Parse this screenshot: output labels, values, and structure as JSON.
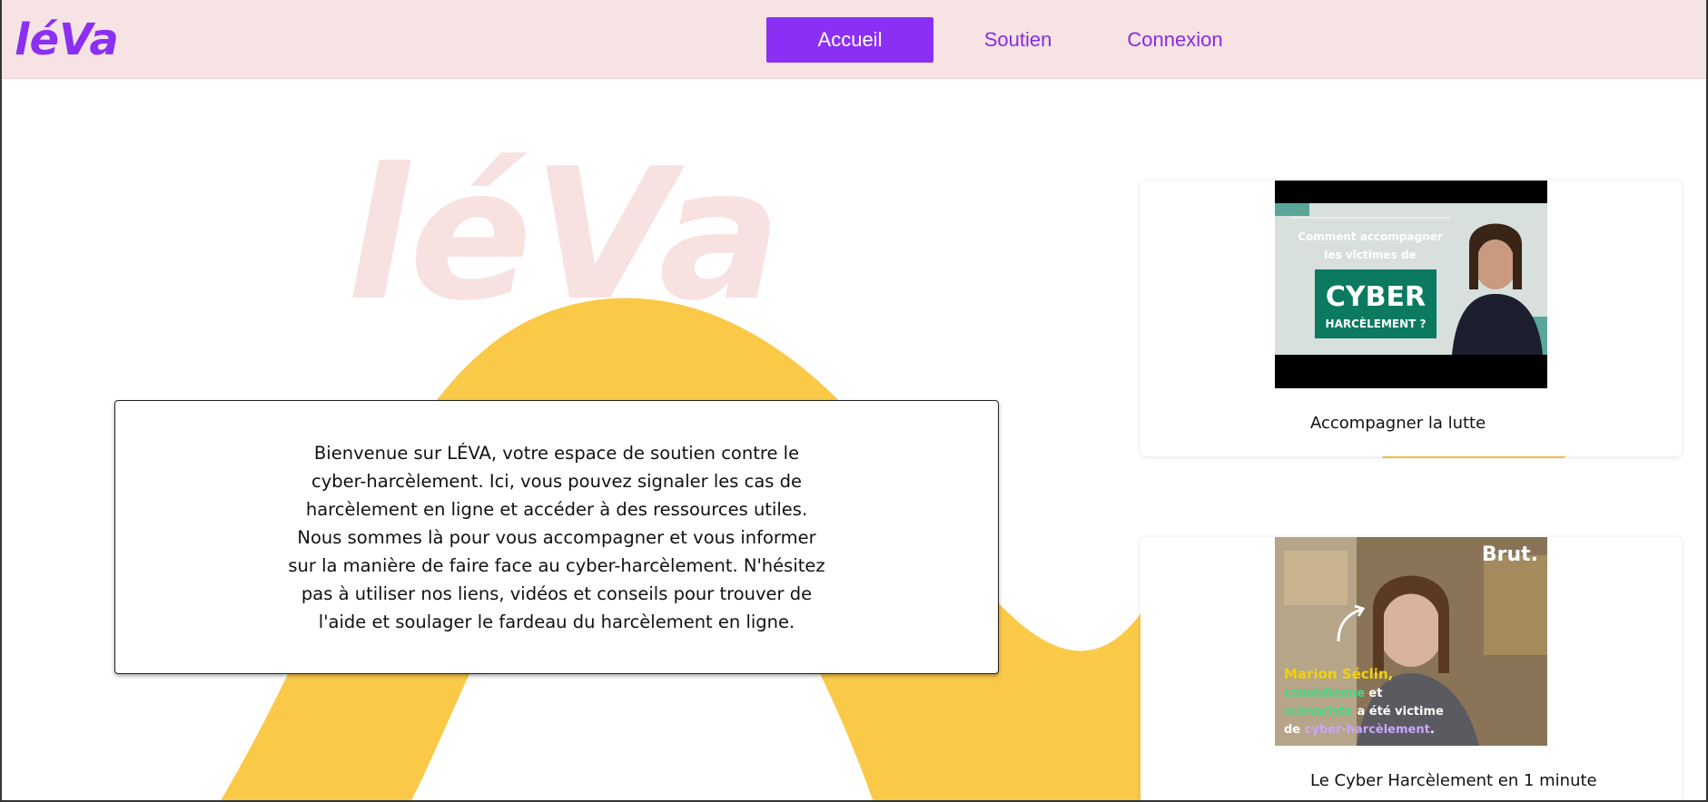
{
  "brand": {
    "logo_text": "léVa",
    "accent_color": "#8b2ff5",
    "header_bg": "#f7e3e4",
    "wave_color": "#fbc948",
    "watermark_color": "#f8e1e1"
  },
  "nav": {
    "items": [
      {
        "label": "Accueil",
        "active": true
      },
      {
        "label": "Soutien",
        "active": false
      },
      {
        "label": "Connexion",
        "active": false
      }
    ]
  },
  "welcome": {
    "text": "Bienvenue sur LÉVA, votre espace de soutien contre le cyber-harcèlement. Ici, vous pouvez signaler les cas de harcèlement en ligne et accéder à des ressources utiles. Nous sommes là pour vous accompagner et vous informer sur la manière de faire face au cyber-harcèlement. N'hésitez pas à utiliser nos liens, vidéos et conseils pour trouver de l'aide et soulager le fardeau du harcèlement en ligne."
  },
  "videos": [
    {
      "caption": "Accompagner la lutte",
      "thumb_line1": "Comment accompagner",
      "thumb_line2": "les victimes de",
      "thumb_big": "CYBER",
      "thumb_sub": "HARCÈLEMENT ?"
    },
    {
      "caption": "Le Cyber Harcèlement en 1 minute",
      "thumb_brand": "Brut.",
      "thumb_name": "Marion Séclin,",
      "thumb_l2a": "comédienne",
      "thumb_l2b": " et",
      "thumb_l3a": "scénariste",
      "thumb_l3b": " a été victime",
      "thumb_l4a": "de ",
      "thumb_l4b": "cyber-harcèlement",
      "thumb_l4c": "."
    }
  ]
}
